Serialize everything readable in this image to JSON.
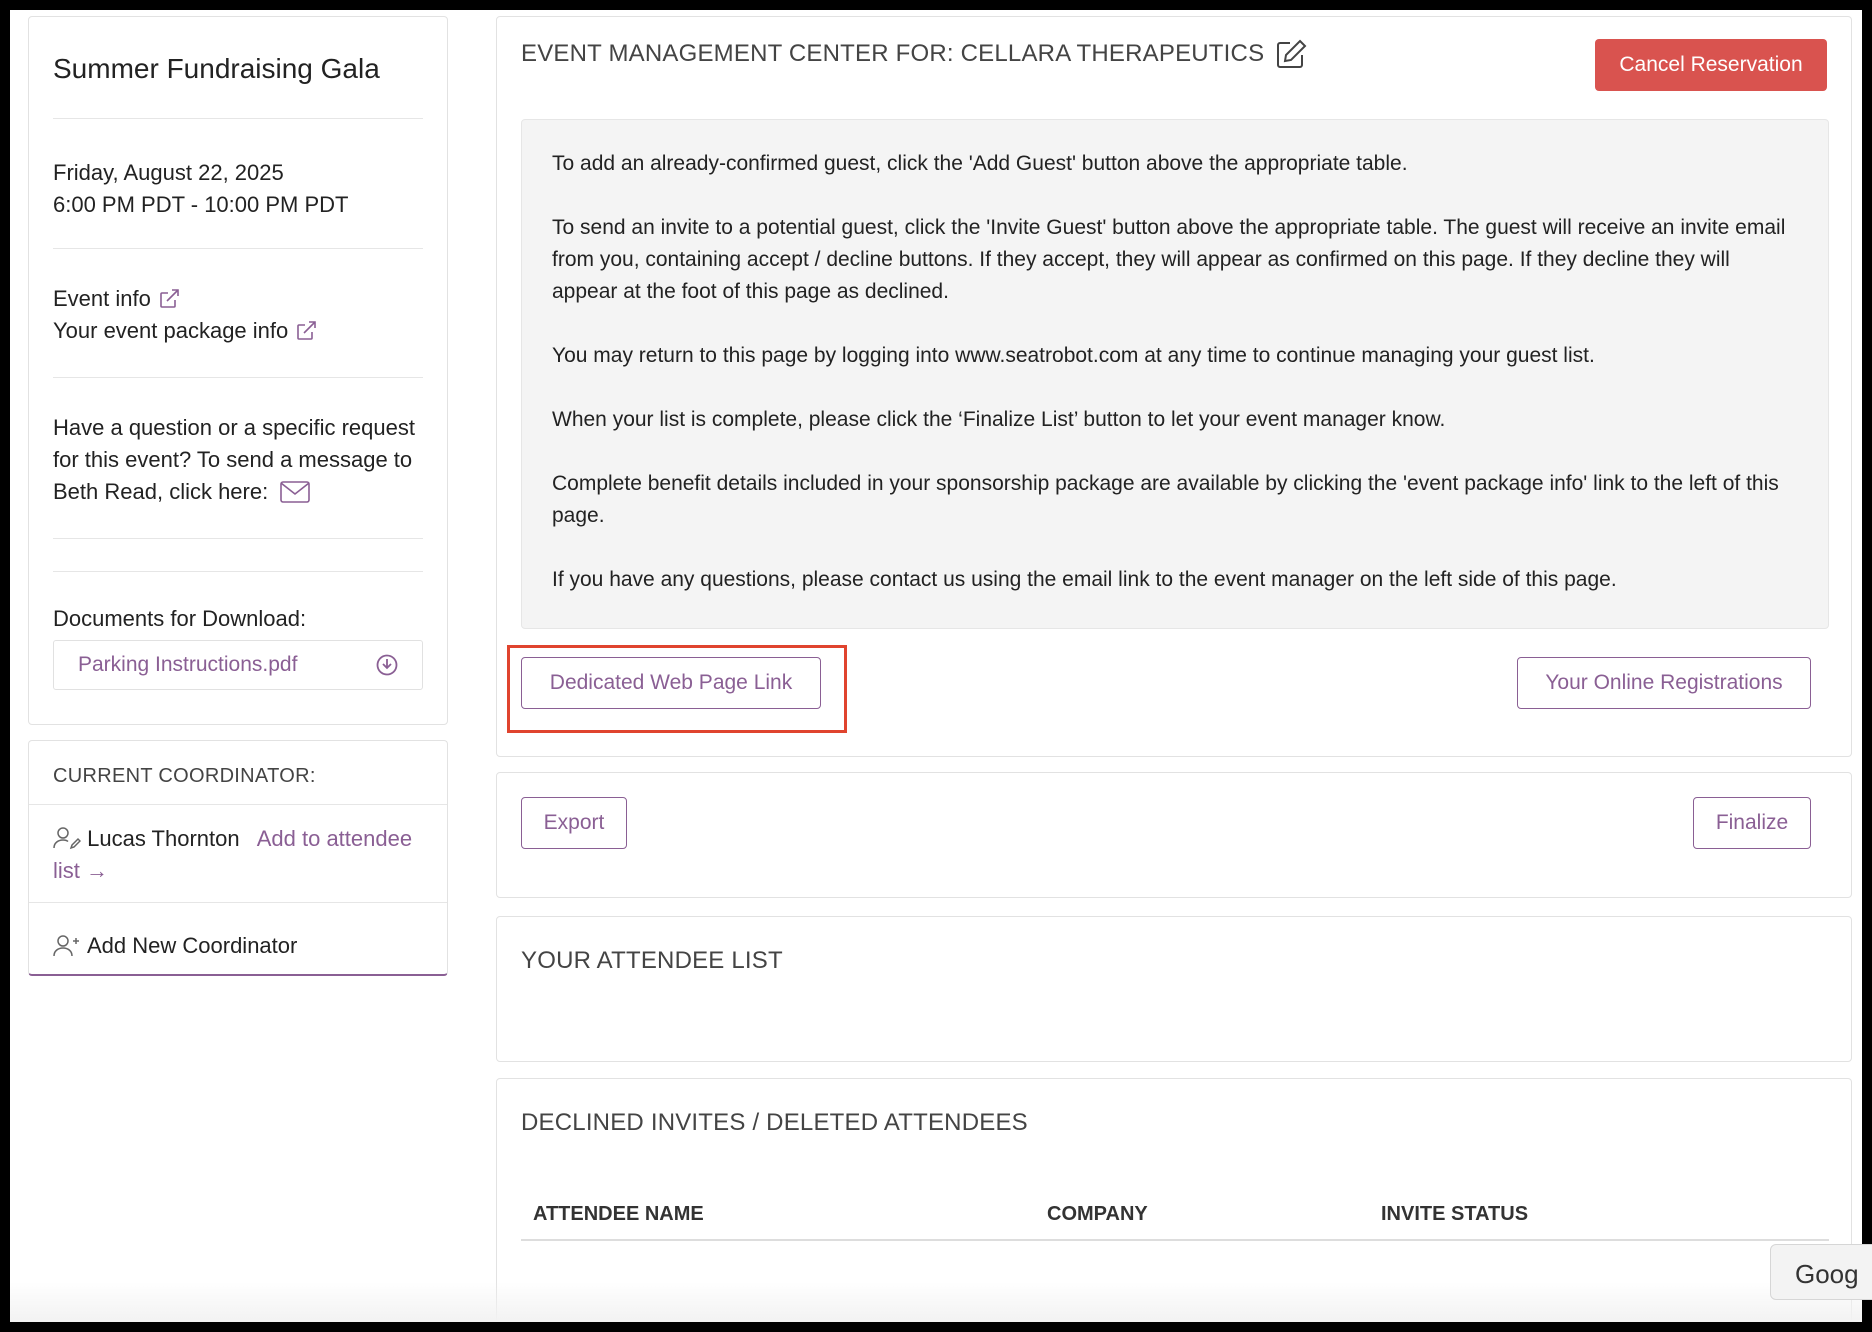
{
  "sidebar": {
    "event_title": "Summer Fundraising Gala",
    "date": "Friday, August 22, 2025",
    "time": "6:00 PM PDT - 10:00 PM PDT",
    "event_info_link": "Event info",
    "package_info_link": "Your event package info",
    "contact_text": "Have a question or a specific request for this event? To send a message to Beth Read, click here:",
    "documents_label": "Documents for Download:",
    "document_name": "Parking Instructions.pdf"
  },
  "coordinator": {
    "heading": "CURRENT COORDINATOR:",
    "name": "Lucas Thornton",
    "add_link": "Add to attendee list",
    "add_new": "Add New Coordinator"
  },
  "main": {
    "heading": "EVENT MANAGEMENT CENTER FOR: CELLARA THERAPEUTICS",
    "cancel_button": "Cancel Reservation",
    "instructions": [
      "To add an already-confirmed guest, click the 'Add Guest' button above the appropriate table.",
      "To send an invite to a potential guest, click the 'Invite Guest' button above the appropriate table. The guest will receive an invite email from you, containing accept / decline buttons. If they accept, they will appear as confirmed on this page. If they decline they will appear at the foot of this page as declined.",
      "You may return to this page by logging into www.seatrobot.com at any time to continue managing your guest list.",
      "When your list is complete, please click the ‘Finalize List’ button to let your event manager know.",
      "Complete benefit details included in your sponsorship package are available by clicking the 'event package info' link to the left of this page.",
      "If you have any questions, please contact us using the email link to the event manager on the left side of this page."
    ],
    "dedicated_link_button": "Dedicated Web Page Link",
    "online_registrations_button": "Your Online Registrations",
    "export_button": "Export",
    "finalize_button": "Finalize",
    "attendee_list_title": "YOUR ATTENDEE LIST",
    "declined_title": "DECLINED INVITES / DELETED ATTENDEES",
    "declined_columns": [
      "ATTENDEE NAME",
      "COMPANY",
      "INVITE STATUS"
    ]
  },
  "overlay": {
    "google_chip": "Goog"
  },
  "colors": {
    "accent": "#8a5f94",
    "danger": "#d9534f",
    "highlight": "#e0442e"
  }
}
